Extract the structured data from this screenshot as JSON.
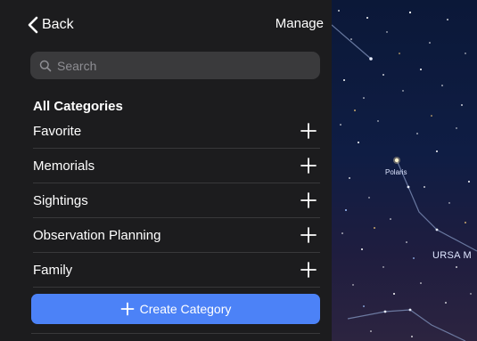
{
  "nav": {
    "back_label": "Back",
    "manage_label": "Manage"
  },
  "search": {
    "placeholder": "Search",
    "value": ""
  },
  "section_title": "All Categories",
  "categories": [
    {
      "label": "Favorite"
    },
    {
      "label": "Memorials"
    },
    {
      "label": "Sightings"
    },
    {
      "label": "Observation Planning"
    },
    {
      "label": "Family"
    }
  ],
  "create_button": {
    "label": "Create Category"
  },
  "sky": {
    "star_label": "Polaris",
    "constellation_label": "URSA M"
  },
  "colors": {
    "accent": "#4c82f7",
    "panel_bg": "#1c1c1e",
    "search_bg": "#3a3a3c"
  }
}
